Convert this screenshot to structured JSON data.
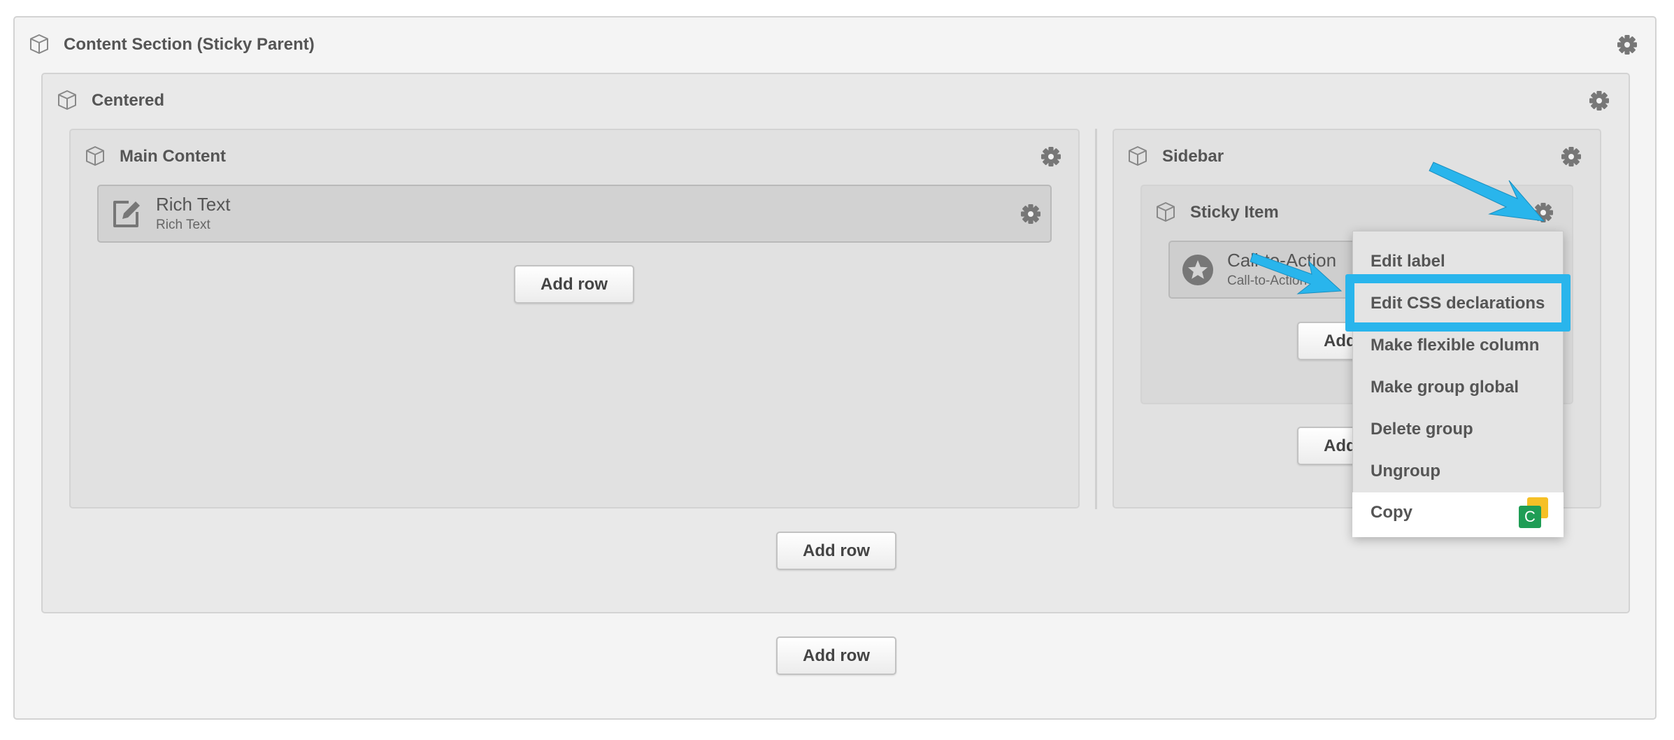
{
  "outer": {
    "title": "Content Section (Sticky Parent)",
    "add_row": "Add row"
  },
  "centered": {
    "title": "Centered",
    "add_row": "Add row"
  },
  "main_content": {
    "title": "Main Content",
    "module": {
      "title": "Rich Text",
      "subtitle": "Rich Text"
    },
    "add_row": "Add row"
  },
  "sidebar": {
    "title": "Sidebar",
    "sticky_item": {
      "title": "Sticky Item",
      "module": {
        "title": "Call-to-Action",
        "subtitle": "Call-to-Action"
      },
      "add_row": "Add row"
    },
    "add_row": "Add row"
  },
  "context_menu": {
    "items": [
      "Edit label",
      "Edit CSS declarations",
      "Make flexible column",
      "Make group global",
      "Delete group",
      "Ungroup",
      "Copy"
    ],
    "highlighted": "Edit CSS declarations",
    "copy_badge": "C"
  },
  "colors": {
    "annotation": "#29b5ec",
    "badge_green": "#1f9d55",
    "badge_yellow": "#f6c026"
  },
  "icons": [
    "cube-icon",
    "gear-icon",
    "edit-icon",
    "star-icon",
    "arrow-annotation"
  ]
}
